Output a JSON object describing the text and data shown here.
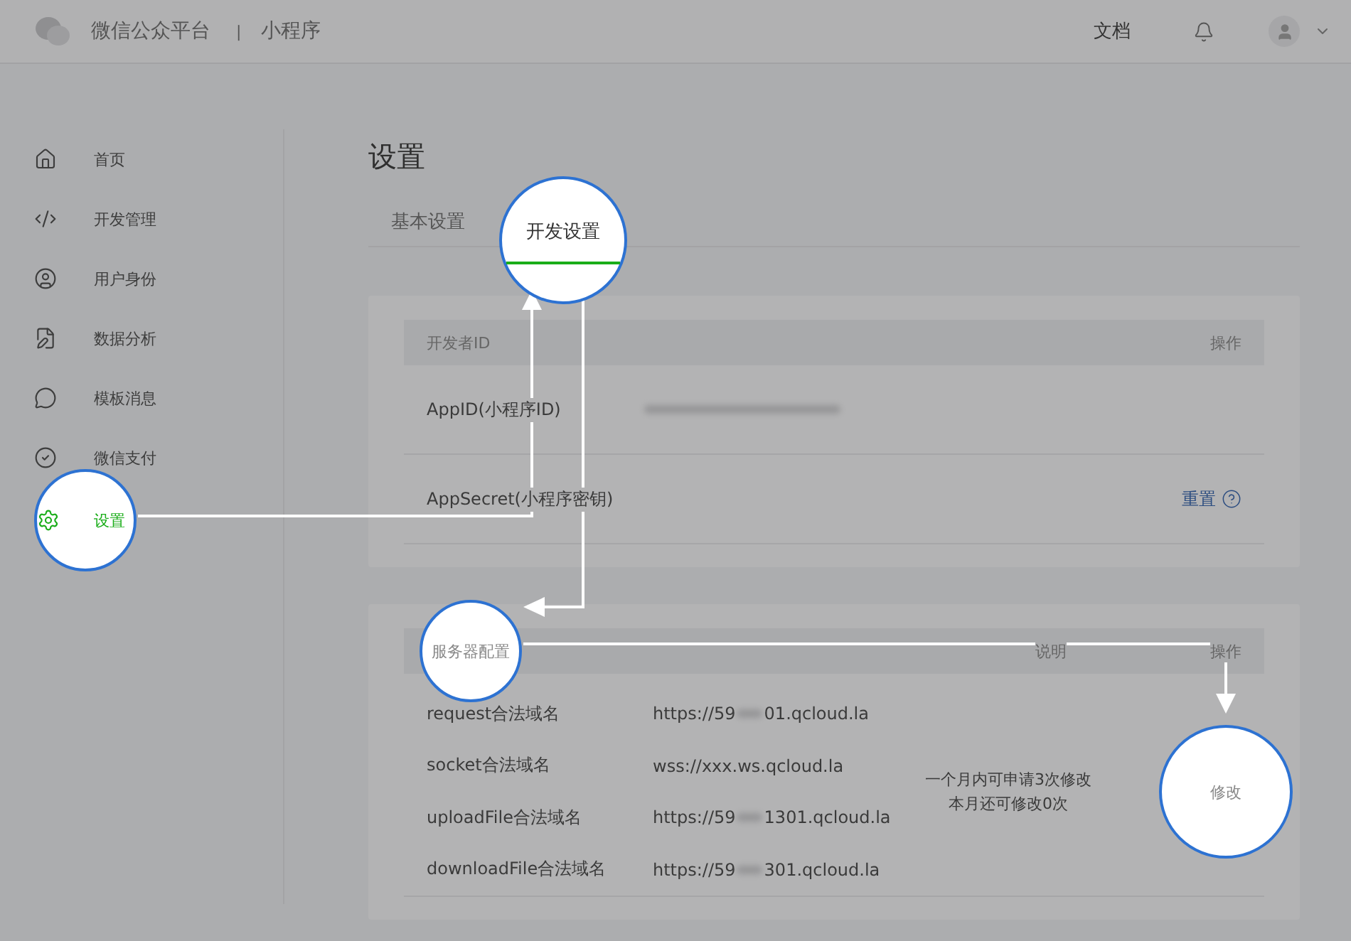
{
  "header": {
    "brand": "微信公众平台",
    "separator": "|",
    "product": "小程序",
    "links": [
      {
        "label": "文档"
      }
    ]
  },
  "sidebar": {
    "items": [
      {
        "label": "首页",
        "selected": false,
        "highlighted": false
      },
      {
        "label": "开发管理",
        "selected": false,
        "highlighted": false
      },
      {
        "label": "用户身份",
        "selected": false,
        "highlighted": false
      },
      {
        "label": "数据分析",
        "selected": false,
        "highlighted": false
      },
      {
        "label": "模板消息",
        "selected": false,
        "highlighted": false
      },
      {
        "label": "微信支付",
        "selected": false,
        "highlighted": false
      },
      {
        "label": "设置",
        "selected": true,
        "highlighted": true
      }
    ]
  },
  "page": {
    "title": "设置"
  },
  "tabs": [
    {
      "label": "基本设置",
      "selected": false,
      "highlighted": false
    },
    {
      "label": "开发设置",
      "selected": true,
      "highlighted": true
    }
  ],
  "developer_id": {
    "header": "开发者ID",
    "action_header": "操作",
    "rows": [
      {
        "label": "AppID(小程序ID)"
      },
      {
        "label": "AppSecret(小程序密钥)",
        "action": "重置"
      }
    ]
  },
  "server": {
    "header": "服务器配置",
    "header_highlighted": true,
    "note_header": "说明",
    "action_header": "操作",
    "rows": [
      {
        "label": "request合法域名",
        "value_parts": [
          "https://59",
          "01.qcloud.la"
        ]
      },
      {
        "label": "socket合法域名",
        "value_parts": [
          "wss://xxx.ws.qcloud.la"
        ]
      },
      {
        "label": "uploadFile合法域名",
        "value_parts": [
          "https://59",
          "1301.qcloud.la"
        ]
      },
      {
        "label": "downloadFile合法域名",
        "value_parts": [
          "https://59",
          "301.qcloud.la"
        ]
      }
    ],
    "note": [
      "一个月内可申请3次修改",
      "本月还可修改0次"
    ],
    "action": {
      "label": "修改",
      "highlighted": true
    }
  }
}
